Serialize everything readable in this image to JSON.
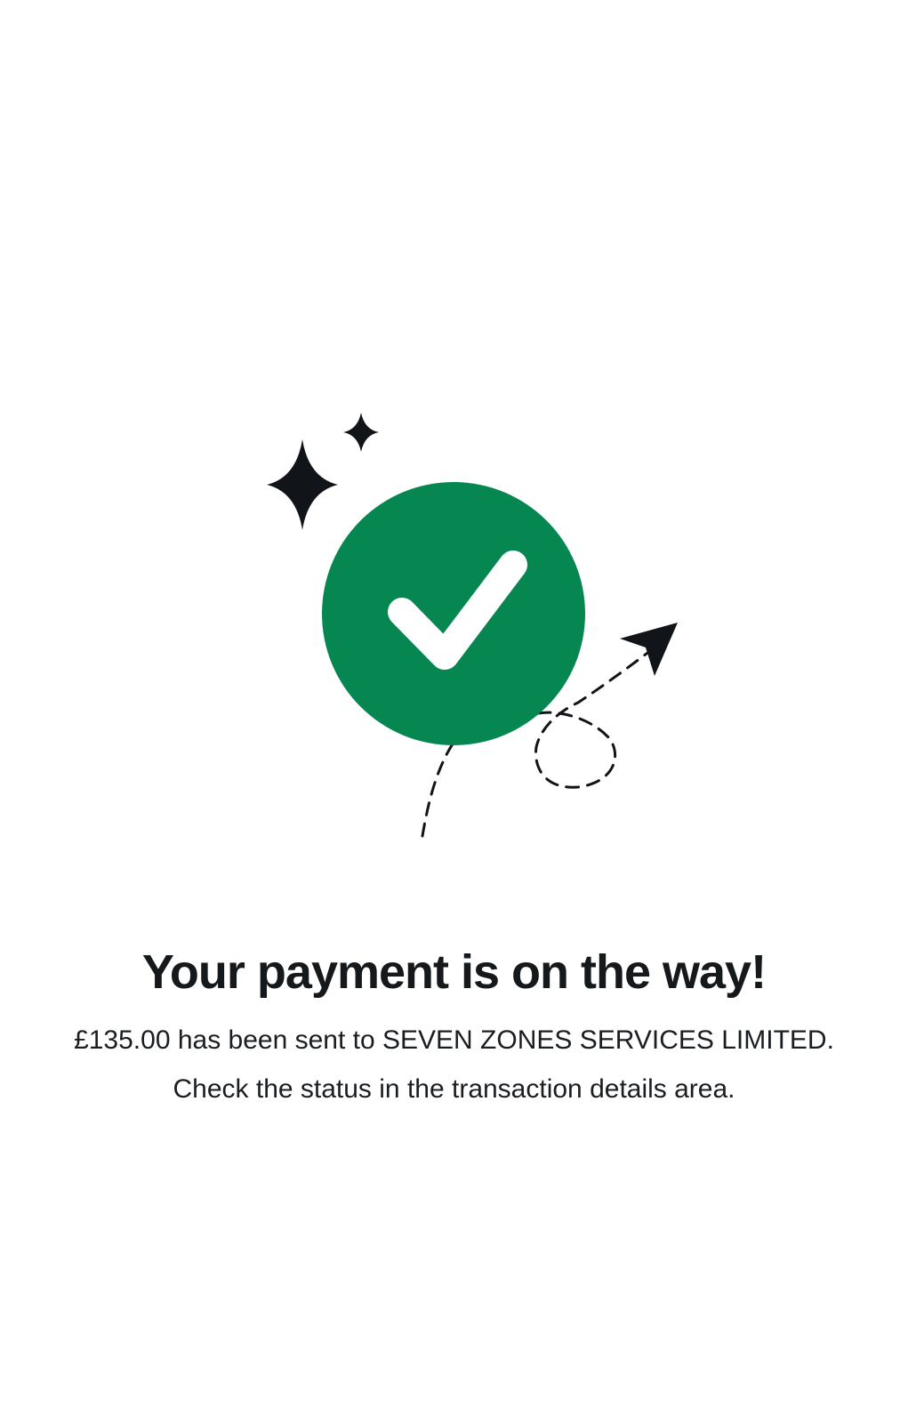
{
  "illustration": {
    "icons": [
      "sparkle-icon",
      "checkmark-icon",
      "paper-plane-icon"
    ],
    "success_color": "#068752",
    "ink_color": "#111418"
  },
  "confirmation": {
    "title": "Your payment is on the way!",
    "message": "£135.00 has been sent to SEVEN ZONES SERVICES LIMITED. Check the status in the transaction details area."
  }
}
